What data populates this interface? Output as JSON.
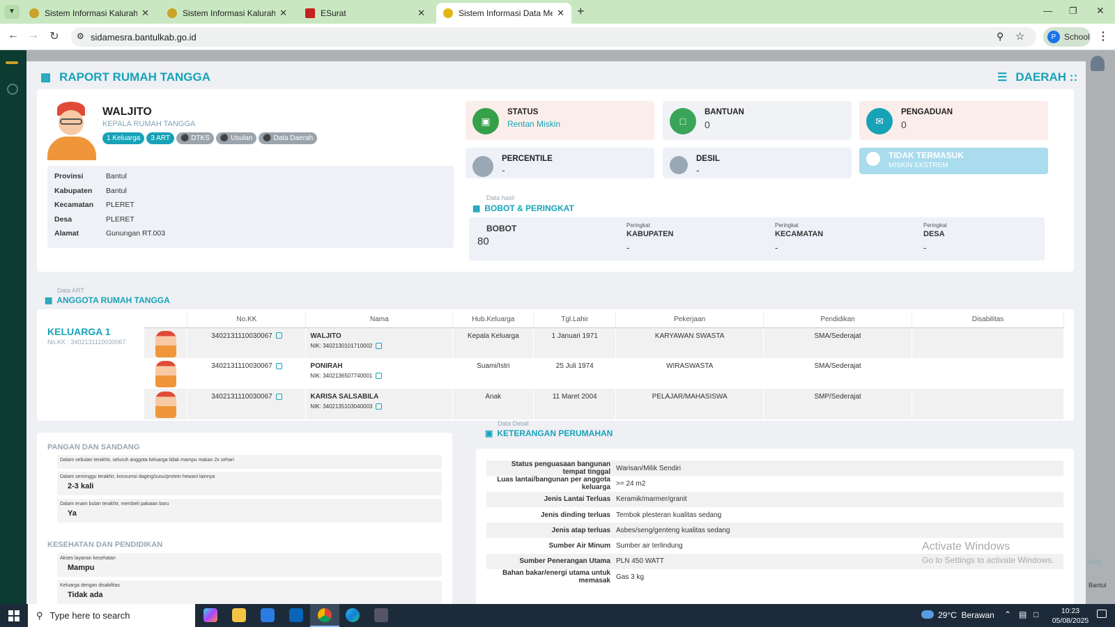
{
  "browser": {
    "tabs": [
      {
        "title": "Sistem Informasi Kalurahan Ple",
        "color": "#c9a227"
      },
      {
        "title": "Sistem Informasi Kalurahan Ple",
        "color": "#c9a227"
      },
      {
        "title": "ESurat",
        "color": "#c5221f"
      },
      {
        "title": "Sistem Informasi Data Menuju S",
        "color": "#e2b714"
      }
    ],
    "url": "sidamesra.bantulkab.go.id",
    "profile": "School",
    "profile_initial": "P"
  },
  "header": {
    "title": "RAPORT RUMAH TANGGA",
    "region": "DAERAH ::"
  },
  "head": {
    "name": "WALJITO",
    "role": "KEPALA RUMAH TANGGA",
    "badges": [
      "1 Keluarga",
      "3 ART",
      "DTKS",
      "Usulan",
      "Data Daerah"
    ]
  },
  "address": [
    {
      "k": "Provinsi",
      "v": "Bantul"
    },
    {
      "k": "Kabupaten",
      "v": "Bantul"
    },
    {
      "k": "Kecamatan",
      "v": "PLERET"
    },
    {
      "k": "Desa",
      "v": "PLERET"
    },
    {
      "k": "Alamat",
      "v": "Gunungan RT.003"
    }
  ],
  "status": {
    "status_label": "STATUS",
    "status_value": "Rentan Miskin",
    "bantuan_label": "BANTUAN",
    "bantuan_value": "0",
    "pengaduan_label": "PENGADUAN",
    "pengaduan_value": "0",
    "percentile_label": "PERCENTILE",
    "percentile_value": "-",
    "desil_label": "DESIL",
    "desil_value": "-",
    "ekstrem_label": "TIDAK TERMASUK",
    "ekstrem_sub": "MISKIN EKSTREM"
  },
  "bobot": {
    "sub": "Data hasil",
    "title": "BOBOT & PERINGKAT",
    "bobot_label": "BOBOT",
    "bobot_value": "80",
    "peringkat_small": "Peringkat",
    "kab_label": "KABUPATEN",
    "kab_value": "-",
    "kec_label": "KECAMATAN",
    "kec_value": "-",
    "desa_label": "DESA",
    "desa_value": "-"
  },
  "art": {
    "sub": "Data ART",
    "title": "ANGGOTA RUMAH TANGGA",
    "keluarga_title": "KELUARGA 1",
    "keluarga_kk": "No.KK : 3402131110030067",
    "columns": [
      "No.KK",
      "Nama",
      "Hub.Keluarga",
      "Tgl.Lahir",
      "Pekerjaan",
      "Pendidikan",
      "Disabilitas"
    ],
    "rows": [
      {
        "kk": "3402131110030067",
        "nama": "WALJITO",
        "nik": "NIK: 3402130101710002",
        "hub": "Kepala Keluarga",
        "tgl": "1 Januari 1971",
        "kerja": "KARYAWAN SWASTA",
        "didik": "SMA/Sederajat",
        "dis": ""
      },
      {
        "kk": "3402131110030067",
        "nama": "PONIRAH",
        "nik": "NIK: 3402136507740001",
        "hub": "Suami/Istri",
        "tgl": "25 Juli 1974",
        "kerja": "WIRASWASTA",
        "didik": "SMA/Sederajat",
        "dis": ""
      },
      {
        "kk": "3402131110030067",
        "nama": "KARISA SALSABILA",
        "nik": "NIK: 3402135103040003",
        "hub": "Anak",
        "tgl": "11 Maret 2004",
        "kerja": "PELAJAR/MAHASISWA",
        "didik": "SMP/Sederajat",
        "dis": ""
      }
    ]
  },
  "pangan": {
    "title": "PANGAN DAN SANDANG",
    "q1": "Dalam sebulan terakhir, seluruh anggota keluarga tidak mampu makan 2x sehari",
    "q2": "Dalam seminggu terakhir, konsumsi daging/susu/protein hewani lainnya",
    "a2": "2-3 kali",
    "q3": "Dalam enam bulan terakhir, membeli pakaian baru",
    "a3": "Ya"
  },
  "kesehatan": {
    "title": "KESEHATAN DAN PENDIDIKAN",
    "q1": "Akses layanan kesehatan",
    "a1": "Mampu",
    "q2": "Keluarga dengan disabilitas",
    "a2": "Tidak ada"
  },
  "perumahan": {
    "sub": "Data Detail",
    "title": "KETERANGAN PERUMAHAN",
    "rows": [
      {
        "k": "Status penguasaan bangunan tempat tinggal",
        "v": "Warisan/Milik Sendiri"
      },
      {
        "k": "Luas lantai/bangunan per anggota keluarga",
        "v": ">= 24 m2"
      },
      {
        "k": "Jenis Lantai Terluas",
        "v": "Keramik/marmer/granit"
      },
      {
        "k": "Jenis dinding terluas",
        "v": "Tembok plesteran kualitas sedang"
      },
      {
        "k": "Jenis atap terluas",
        "v": "Asbes/seng/genteng kualitas sedang"
      },
      {
        "k": "Sumber Air Minum",
        "v": "Sumber air terlindung"
      },
      {
        "k": "Sumber Penerangan Utama",
        "v": "PLN 450 WATT"
      },
      {
        "k": "Bahan bakar/energi utama untuk memasak",
        "v": "Gas 3 kg"
      }
    ]
  },
  "watermark": {
    "line1": "Activate Windows",
    "line2": "Go to Settings to activate Windows."
  },
  "background_fragments": {
    "next": "Next",
    "bantul": "Bantul"
  },
  "taskbar": {
    "search_placeholder": "Type here to search",
    "weather": "29°C  Berawan",
    "time": "10:23",
    "date": "05/08/2025"
  }
}
